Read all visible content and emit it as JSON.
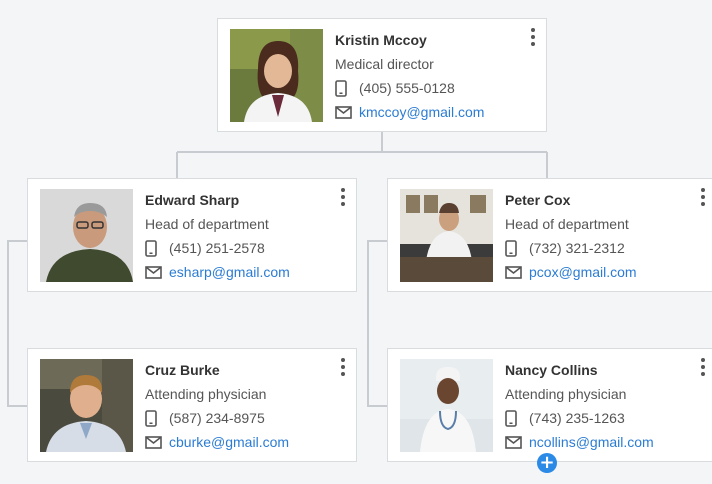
{
  "colors": {
    "background": "#f4f5f6",
    "card_border": "#d9dcdf",
    "connector": "#c8ccd0",
    "link": "#2b7cd3",
    "add_button": "#2b8ae6"
  },
  "nodes": [
    {
      "id": "kristin",
      "name": "Kristin Mccoy",
      "title": "Medical director",
      "phone": "(405) 555-0128",
      "email": "kmccoy@gmail.com",
      "photo": "woman-doctor-photo"
    },
    {
      "id": "edward",
      "name": "Edward Sharp",
      "title": "Head of department",
      "phone": "(451) 251-2578",
      "email": "esharp@gmail.com",
      "photo": "man-glasses-photo"
    },
    {
      "id": "peter",
      "name": "Peter Cox",
      "title": "Head of department",
      "phone": "(732) 321-2312",
      "email": "pcox@gmail.com",
      "photo": "man-doctor-desk-photo"
    },
    {
      "id": "cruz",
      "name": "Cruz Burke",
      "title": "Attending physician",
      "phone": "(587) 234-8975",
      "email": "cburke@gmail.com",
      "photo": "young-man-photo"
    },
    {
      "id": "nancy",
      "name": "Nancy Collins",
      "title": "Attending physician",
      "phone": "(743) 235-1263",
      "email": "ncollins@gmail.com",
      "photo": "woman-nurse-photo"
    }
  ],
  "icons": {
    "phone": "phone-icon",
    "email": "mail-icon",
    "menu": "more-vertical-icon",
    "add": "plus-icon"
  },
  "add_button_label": "+"
}
